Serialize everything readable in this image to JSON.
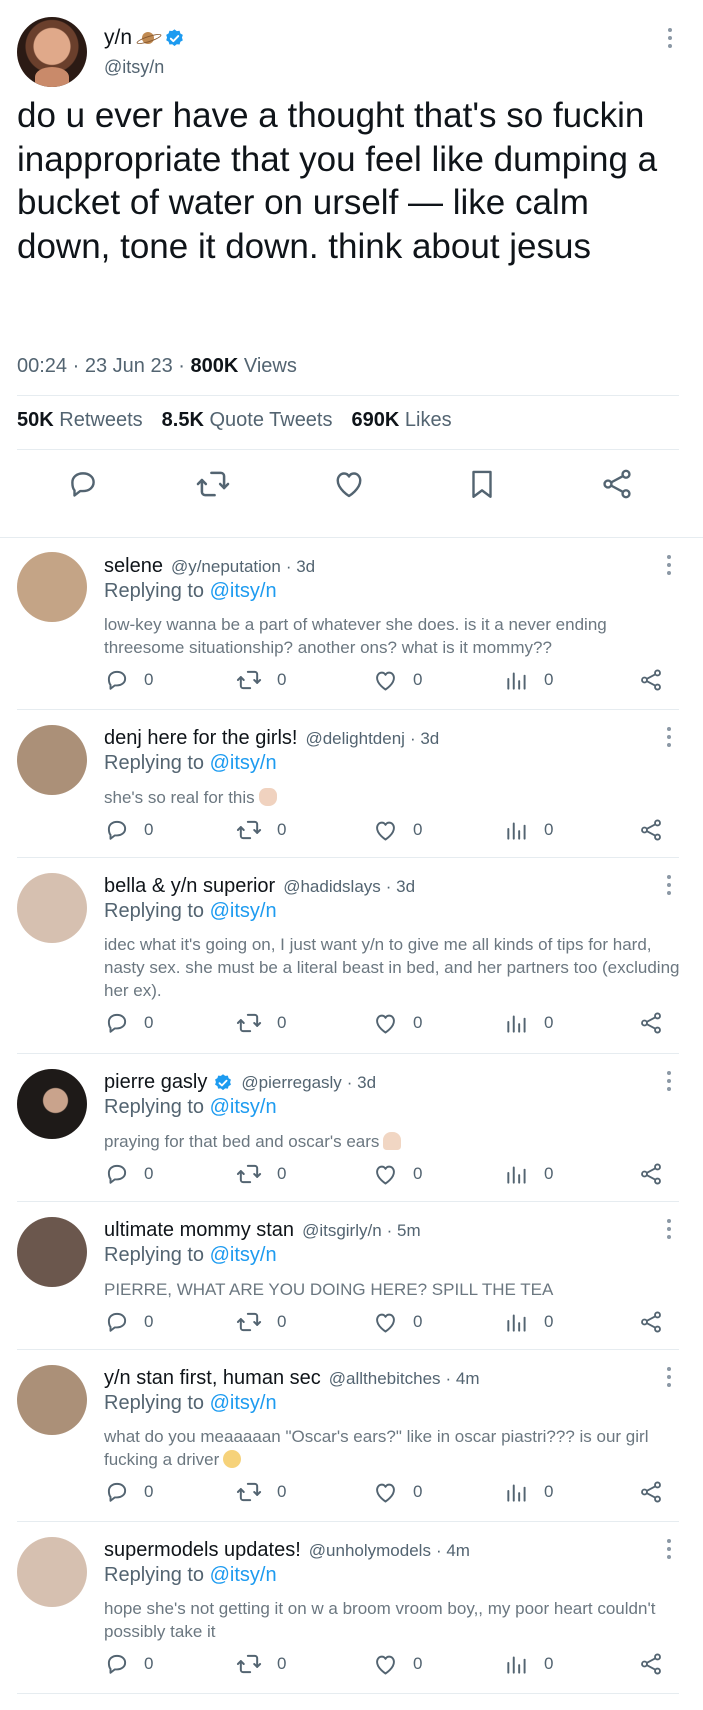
{
  "tweet": {
    "name": "y/n",
    "handle": "@itsy/n",
    "text": "do u ever have a thought that's so fuckin inappropriate that you feel like dumping a bucket of water on urself — like calm down, tone it down. think about jesus",
    "time": "00:24",
    "date": "23 Jun 23",
    "views_count": "800K",
    "views_label": "Views",
    "retweets_count": "50K",
    "retweets_label": "Retweets",
    "quotes_count": "8.5K",
    "quotes_label": "Quote Tweets",
    "likes_count": "690K",
    "likes_label": "Likes",
    "icons": [
      "planet-emoji",
      "verified-badge",
      "more-icon",
      "reply-icon",
      "retweet-icon",
      "like-icon",
      "bookmark-icon",
      "share-icon"
    ]
  },
  "replying_label": "Replying to",
  "replying_target": "@itsy/n",
  "replies": [
    {
      "name": "selene",
      "handle": "@y/neputation",
      "time": "· 3d",
      "verified": false,
      "text": "low-key wanna be a part of whatever she does. is it a never ending threesome situationship? another ons? what is it mommy??",
      "avatar_color": "#c4a486",
      "replies": "0",
      "retweets": "0",
      "likes": "0",
      "views": "0"
    },
    {
      "name": "denj here for the girls!",
      "handle": "@delightdenj",
      "time": "· 3d",
      "verified": false,
      "text": "she's so real for this",
      "emoji": "raised-hand",
      "avatar_color": "#ab9078",
      "replies": "0",
      "retweets": "0",
      "likes": "0",
      "views": "0"
    },
    {
      "name": "bella & y/n superior",
      "handle": "@hadidslays",
      "time": "· 3d",
      "verified": false,
      "text": "idec what it's going on, I just want y/n to give me all kinds of tips for hard, nasty sex. she must be a literal beast in bed, and her partners too (excluding her ex).",
      "avatar_color": "#d6c0b0",
      "replies": "0",
      "retweets": "0",
      "likes": "0",
      "views": "0"
    },
    {
      "name": "pierre gasly",
      "handle": "@pierregasly",
      "time": "· 3d",
      "verified": true,
      "text": "praying for that bed and oscar's ears",
      "emoji": "folded-hands",
      "avatar_color": "#2a2320",
      "replies": "0",
      "retweets": "0",
      "likes": "0",
      "views": "0"
    },
    {
      "name": "ultimate mommy stan",
      "handle": "@itsgirly/n",
      "time": "· 5m",
      "verified": false,
      "text": "PIERRE, WHAT ARE YOU DOING HERE? SPILL THE TEA",
      "avatar_color": "#6b574d",
      "replies": "0",
      "retweets": "0",
      "likes": "0",
      "views": "0"
    },
    {
      "name": "y/n stan first, human sec",
      "handle": "@allthebitches",
      "time": "· 4m",
      "verified": false,
      "text": "what do you meaaaaan \"Oscar's ears?\" like in oscar piastri??? is our girl fucking a driver",
      "emoji": "neutral-face",
      "avatar_color": "#ab9078",
      "replies": "0",
      "retweets": "0",
      "likes": "0",
      "views": "0"
    },
    {
      "name": "supermodels updates!",
      "handle": "@unholymodels",
      "time": "· 4m",
      "verified": false,
      "text": "hope she's not getting it on w a broom vroom boy,, my poor heart couldn't possibly take it",
      "avatar_color": "#d6c0b0",
      "replies": "0",
      "retweets": "0",
      "likes": "0",
      "views": "0"
    }
  ],
  "colors": {
    "accent": "#1d9bf0",
    "text": "#0f1419",
    "muted": "#536471",
    "divider": "#e6ecf0"
  }
}
